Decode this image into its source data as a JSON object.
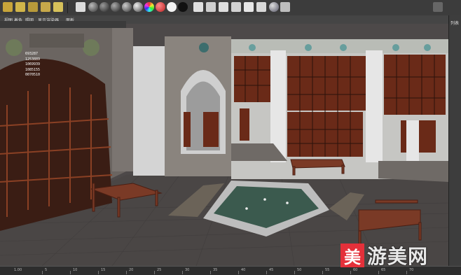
{
  "viewport_menu": {
    "items": [
      "视图",
      "着色",
      "照明",
      "显示",
      "渲染器",
      "面板"
    ]
  },
  "right_panel": {
    "label": "列表"
  },
  "hud_stats": [
    "693287",
    "1253889",
    "1069939",
    "1085155",
    "0070510"
  ],
  "timeline": {
    "start_label": "1.00",
    "marks": [
      "5",
      "10",
      "15",
      "20",
      "25",
      "30",
      "35",
      "40",
      "45",
      "50",
      "55",
      "60",
      "65",
      "70"
    ]
  },
  "watermark": {
    "badge": "美",
    "text": "游美网"
  },
  "colors": {
    "toolbar_bg": "#3c3c3c",
    "window_wood": "#6a2a18",
    "floor": "#4a4645",
    "watermark_red": "#e4303a"
  }
}
